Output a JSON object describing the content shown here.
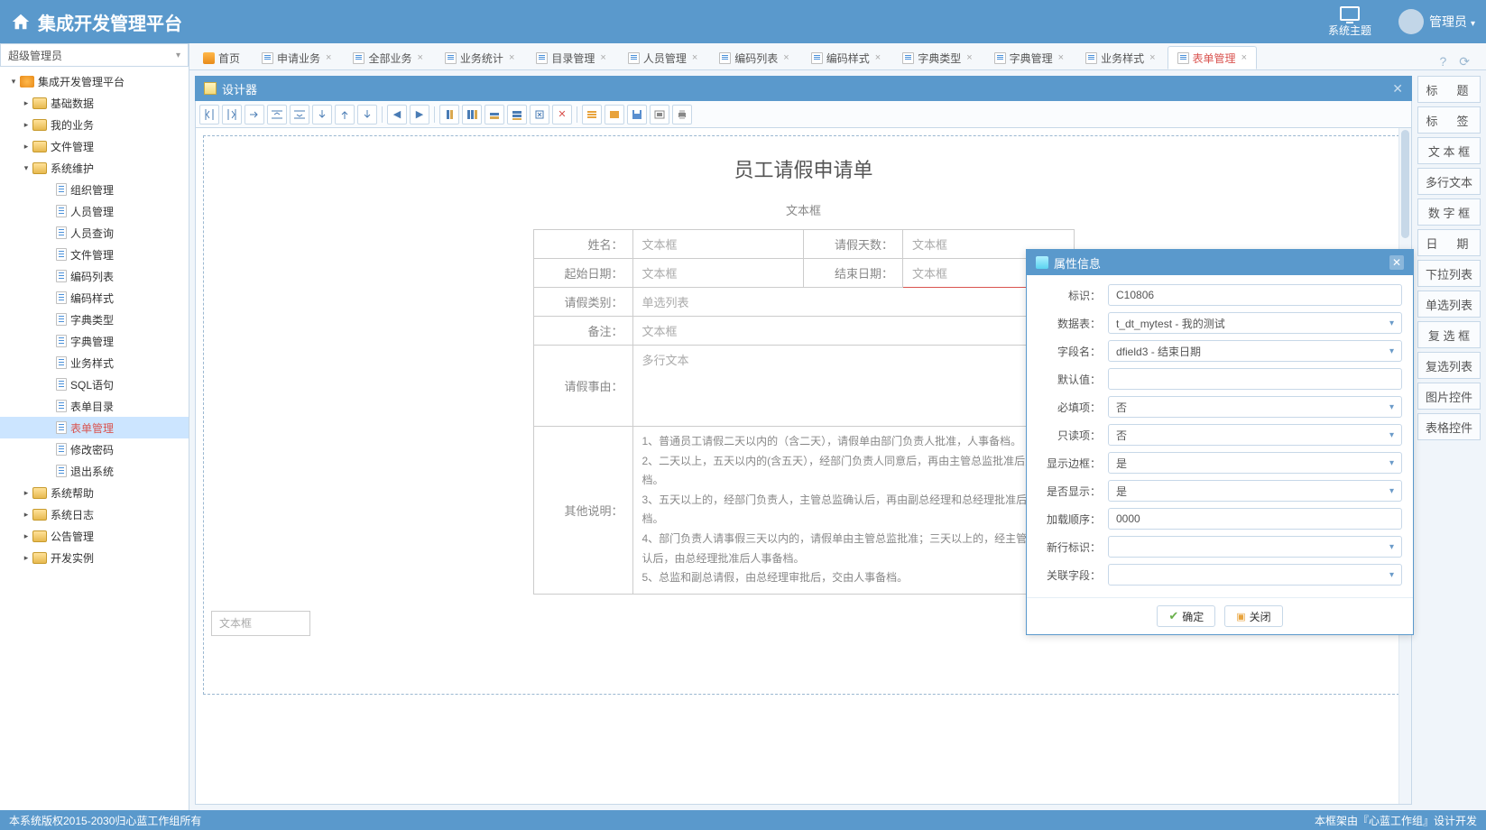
{
  "header": {
    "title": "集成开发管理平台",
    "theme_label": "系统主题",
    "user_name": "管理员"
  },
  "sidebar": {
    "role": "超级管理员",
    "root": "集成开发管理平台",
    "groups": [
      {
        "label": "基础数据",
        "expanded": false
      },
      {
        "label": "我的业务",
        "expanded": false
      },
      {
        "label": "文件管理",
        "expanded": false
      },
      {
        "label": "系统维护",
        "expanded": true,
        "children": [
          "组织管理",
          "人员管理",
          "人员查询",
          "文件管理",
          "编码列表",
          "编码样式",
          "字典类型",
          "字典管理",
          "业务样式",
          "SQL语句",
          "表单目录",
          "表单管理",
          "修改密码",
          "退出系统"
        ],
        "selected_child": "表单管理"
      },
      {
        "label": "系统帮助",
        "expanded": false
      },
      {
        "label": "系统日志",
        "expanded": false
      },
      {
        "label": "公告管理",
        "expanded": false
      },
      {
        "label": "开发实例",
        "expanded": false
      }
    ]
  },
  "tabs": {
    "items": [
      {
        "label": "首页",
        "type": "home"
      },
      {
        "label": "申请业务",
        "type": "page"
      },
      {
        "label": "全部业务",
        "type": "page"
      },
      {
        "label": "业务统计",
        "type": "page"
      },
      {
        "label": "目录管理",
        "type": "page"
      },
      {
        "label": "人员管理",
        "type": "page"
      },
      {
        "label": "编码列表",
        "type": "page"
      },
      {
        "label": "编码样式",
        "type": "page"
      },
      {
        "label": "字典类型",
        "type": "page"
      },
      {
        "label": "字典管理",
        "type": "page"
      },
      {
        "label": "业务样式",
        "type": "page"
      },
      {
        "label": "表单管理",
        "type": "page",
        "selected": true
      }
    ]
  },
  "designer": {
    "title": "设计器",
    "form_title": "员工请假申请单",
    "sub_text": "文本框",
    "lone_box": "文本框",
    "rows": {
      "name_lbl": "姓名：",
      "name_val": "文本框",
      "days_lbl": "请假天数：",
      "days_val": "文本框",
      "start_lbl": "起始日期：",
      "start_val": "文本框",
      "end_lbl": "结束日期：",
      "end_val": "文本框",
      "type_lbl": "请假类别：",
      "type_val": "单选列表",
      "remark_lbl": "备注：",
      "remark_val": "文本框",
      "reason_lbl": "请假事由：",
      "reason_val": "多行文本",
      "other_lbl": "其他说明：",
      "other_lines": [
        "1、普通员工请假二天以内的（含二天），请假单由部门负责人批准，人事备档。",
        "2、二天以上，五天以内的(含五天），经部门负责人同意后，再由主管总监批准后人事备档。",
        "3、五天以上的，经部门负责人，主管总监确认后，再由副总经理和总经理批准后人事备档。",
        "4、部门负责人请事假三天以内的，请假单由主管总监批准；三天以上的，经主管副总确认后，由总经理批准后人事备档。",
        "5、总监和副总请假，由总经理审批后，交由人事备档。"
      ]
    }
  },
  "palette": [
    "标　题",
    "标　签",
    "文 本 框",
    "多行文本",
    "数 字 框",
    "日　期",
    "下拉列表",
    "单选列表",
    "复 选 框",
    "复选列表",
    "图片控件",
    "表格控件"
  ],
  "dialog": {
    "title": "属性信息",
    "fields": {
      "id_lbl": "标识：",
      "id_val": "C10806",
      "table_lbl": "数据表：",
      "table_val": "t_dt_mytest - 我的测试",
      "field_lbl": "字段名：",
      "field_val": "dfield3 - 结束日期",
      "default_lbl": "默认值：",
      "default_val": "",
      "required_lbl": "必填项：",
      "required_val": "否",
      "readonly_lbl": "只读项：",
      "readonly_val": "否",
      "border_lbl": "显示边框：",
      "border_val": "是",
      "visible_lbl": "是否显示：",
      "visible_val": "是",
      "order_lbl": "加载顺序：",
      "order_val": "0000",
      "newrow_lbl": "新行标识：",
      "newrow_val": "",
      "relate_lbl": "关联字段：",
      "relate_val": ""
    },
    "ok_label": "确定",
    "close_label": "关闭"
  },
  "footer": {
    "left": "本系统版权2015-2030归心蓝工作组所有",
    "right": "本框架由『心蓝工作组』设计开发"
  },
  "colors": {
    "accent": "#5a99cc",
    "danger": "#d9534f"
  }
}
